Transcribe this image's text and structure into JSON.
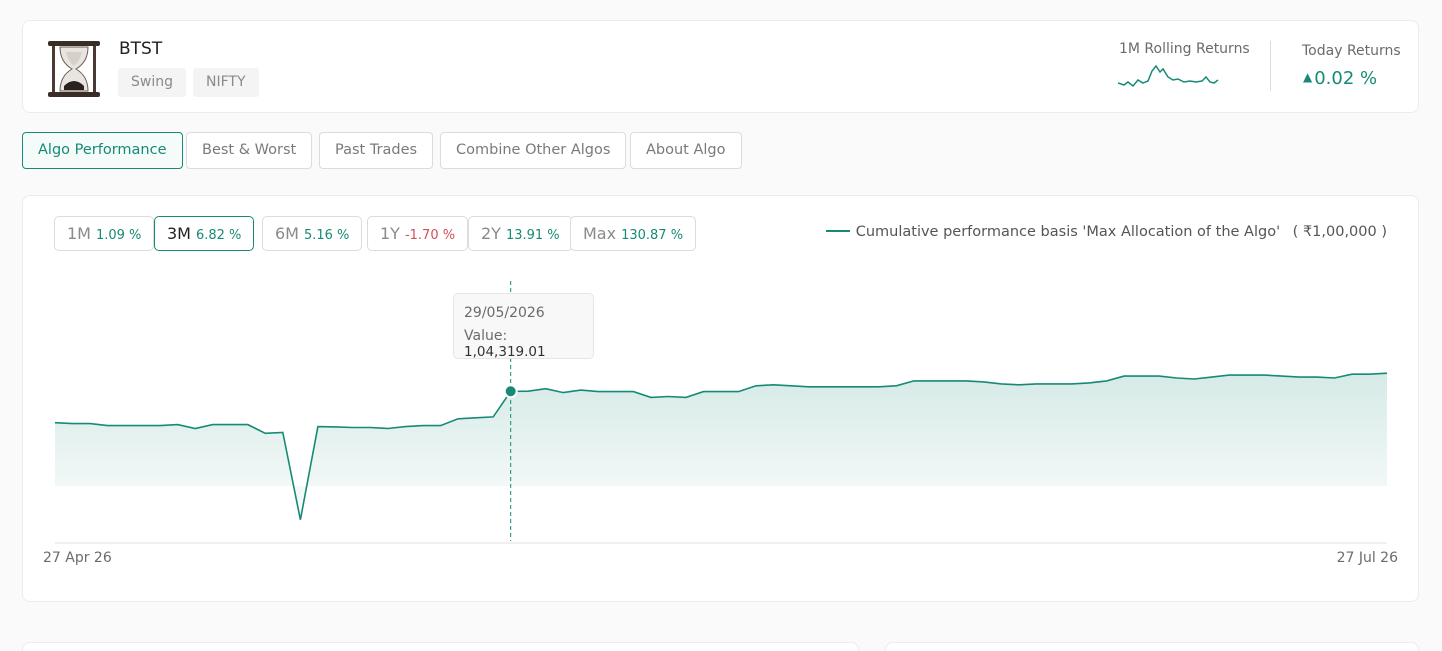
{
  "header": {
    "title": "BTST",
    "tags": [
      "Swing",
      "NIFTY"
    ],
    "rolling_label": "1M Rolling Returns",
    "today_label": "Today Returns",
    "today_value": "0.02 %"
  },
  "tabs": [
    {
      "label": "Algo Performance",
      "active": true
    },
    {
      "label": "Best & Worst",
      "active": false
    },
    {
      "label": "Past Trades",
      "active": false
    },
    {
      "label": "Combine Other Algos",
      "active": false
    },
    {
      "label": "About Algo",
      "active": false
    }
  ],
  "periods": [
    {
      "label": "1M",
      "value": "1.09 %",
      "negative": false,
      "active": false
    },
    {
      "label": "3M",
      "value": "6.82 %",
      "negative": false,
      "active": true
    },
    {
      "label": "6M",
      "value": "5.16 %",
      "negative": false,
      "active": false
    },
    {
      "label": "1Y",
      "value": "-1.70 %",
      "negative": true,
      "active": false
    },
    {
      "label": "2Y",
      "value": "13.91 %",
      "negative": false,
      "active": false
    },
    {
      "label": "Max",
      "value": "130.87 %",
      "negative": false,
      "active": false
    }
  ],
  "legend": {
    "text": "Cumulative performance basis 'Max Allocation of the Algo'",
    "amount": "( ₹1,00,000 )"
  },
  "tooltip": {
    "date": "29/05/2026",
    "value_label": "Value:",
    "value": "1,04,319.01"
  },
  "colors": {
    "accent": "#178a76",
    "negative": "#d0505a"
  },
  "chart_data": {
    "type": "area",
    "x_start_label": "27 Apr 26",
    "x_end_label": "27 Jul 26",
    "ylim": [
      96500,
      110000
    ],
    "values": [
      102700,
      102650,
      102650,
      102550,
      102550,
      102550,
      102550,
      102600,
      102400,
      102600,
      102600,
      102600,
      102150,
      102200,
      97700,
      102500,
      102480,
      102450,
      102450,
      102400,
      102500,
      102550,
      102550,
      102900,
      102950,
      103000,
      104319,
      104320,
      104450,
      104250,
      104380,
      104300,
      104300,
      104300,
      104000,
      104050,
      104000,
      104300,
      104300,
      104300,
      104600,
      104650,
      104600,
      104550,
      104550,
      104550,
      104550,
      104550,
      104600,
      104850,
      104850,
      104850,
      104850,
      104800,
      104700,
      104650,
      104700,
      104700,
      104700,
      104750,
      104850,
      105100,
      105100,
      105100,
      105000,
      104950,
      105050,
      105150,
      105150,
      105150,
      105100,
      105050,
      105050,
      105000,
      105200,
      105200,
      105250
    ],
    "highlight_index": 26
  }
}
